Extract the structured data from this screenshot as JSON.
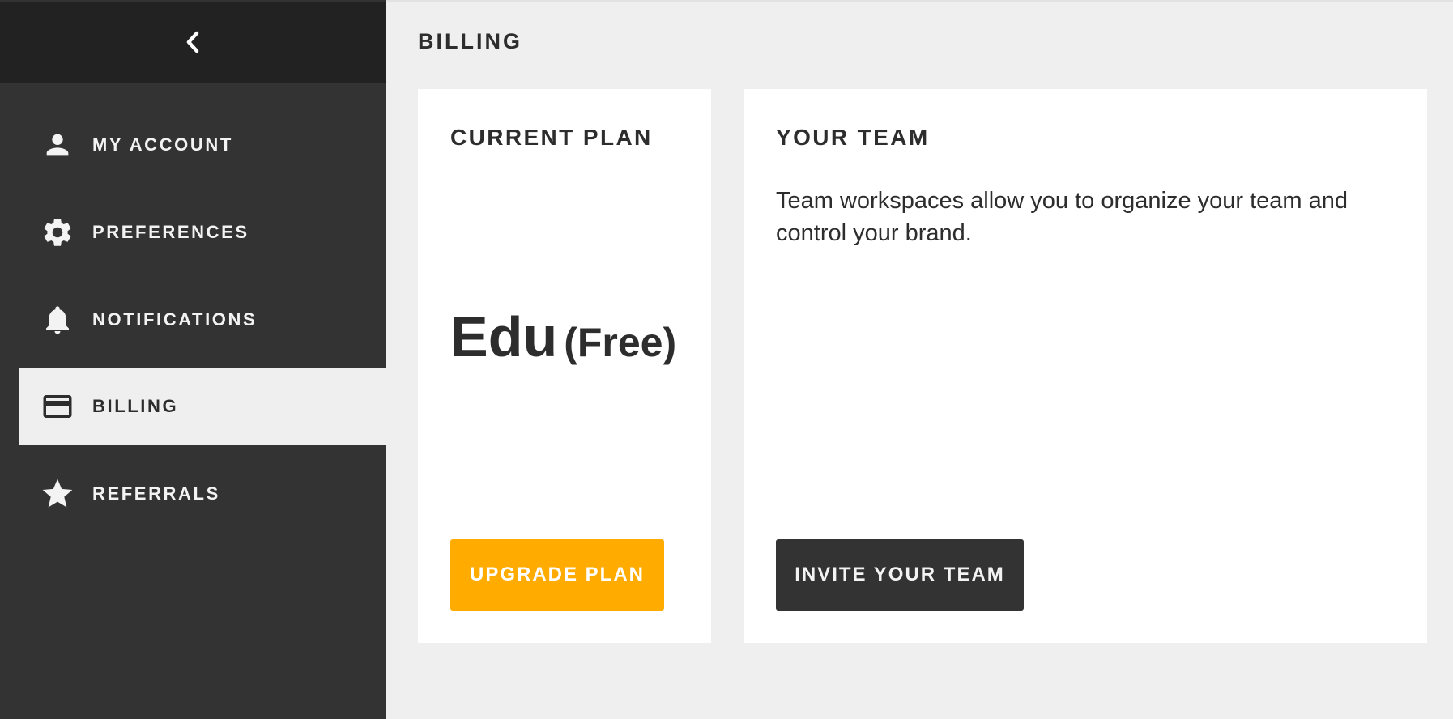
{
  "sidebar": {
    "back_icon": "chevron-left-icon",
    "items": [
      {
        "label": "MY ACCOUNT",
        "icon": "person-icon",
        "active": false
      },
      {
        "label": "PREFERENCES",
        "icon": "gear-icon",
        "active": false
      },
      {
        "label": "NOTIFICATIONS",
        "icon": "bell-icon",
        "active": false
      },
      {
        "label": "BILLING",
        "icon": "credit-card-icon",
        "active": true
      },
      {
        "label": "REFERRALS",
        "icon": "star-icon",
        "active": false
      }
    ]
  },
  "page": {
    "title": "BILLING"
  },
  "current_plan": {
    "title": "CURRENT PLAN",
    "plan_name": "Edu",
    "plan_price": "(Free)",
    "button_label": "UPGRADE PLAN"
  },
  "team": {
    "title": "YOUR TEAM",
    "description": "Team workspaces allow you to organize your team and control your brand.",
    "button_label": "INVITE YOUR TEAM"
  },
  "colors": {
    "sidebar_bg": "#333333",
    "sidebar_header_bg": "#222222",
    "page_bg": "#efefef",
    "accent_upgrade": "#ffab00",
    "invite_button_bg": "#333333"
  }
}
